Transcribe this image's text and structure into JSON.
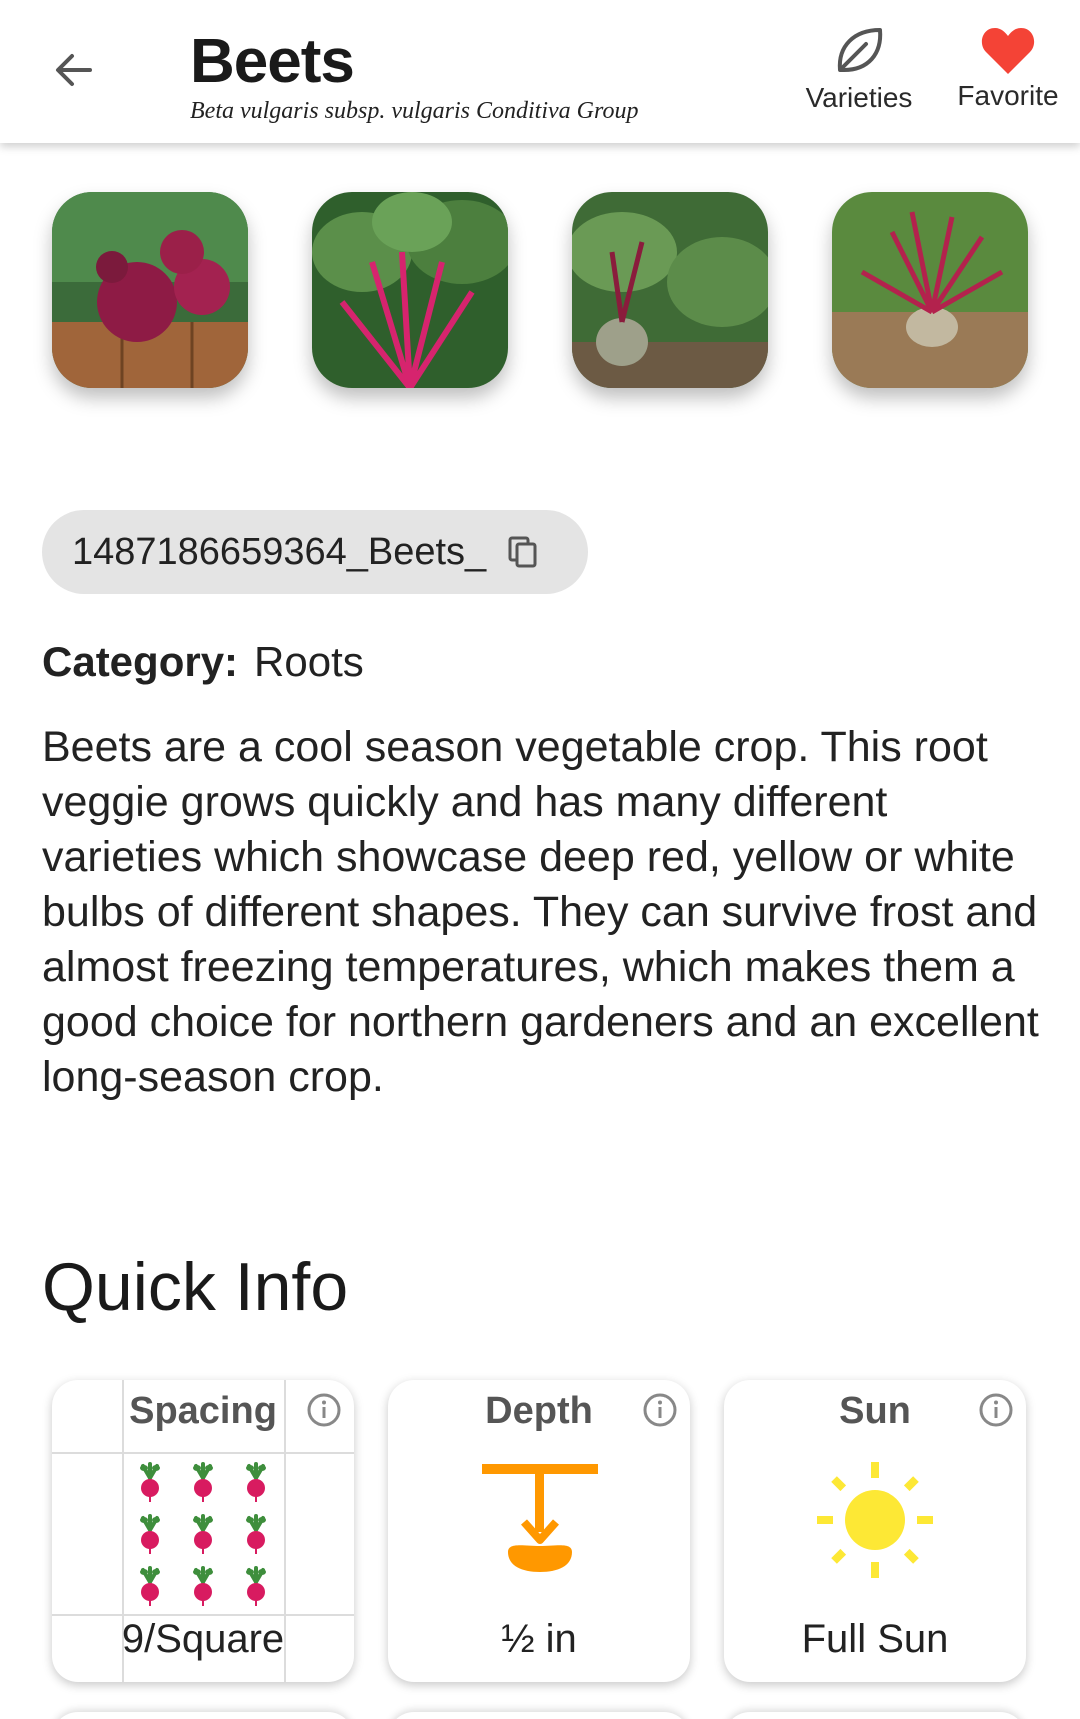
{
  "header": {
    "title": "Beets",
    "subtitle": "Beta vulgaris subsp. vulgaris Conditiva Group",
    "varieties_label": "Varieties",
    "favorite_label": "Favorite",
    "favorite_color": "#f44336"
  },
  "gallery": {
    "images": [
      "beets-on-wooden-table",
      "beet-leaves-pink-stems",
      "beets-growing-in-garden",
      "beet-root-in-soil"
    ]
  },
  "plant_id": "1487186659364_Beets_",
  "category": {
    "label": "Category:",
    "value": "Roots"
  },
  "description": "Beets are a cool season vegetable crop. This root veggie grows quickly and has many different varieties which showcase deep red, yellow or white bulbs of different shapes. They can survive frost and almost freezing temperatures, which makes them a good choice for northern gardeners and an excellent long-season crop.",
  "quick_info": {
    "title": "Quick Info",
    "cards": [
      {
        "title": "Spacing",
        "value": "9/Square",
        "icon": "beet-grid-icon"
      },
      {
        "title": "Depth",
        "value": "½ in",
        "icon": "seed-depth-icon",
        "color": "#ff9800"
      },
      {
        "title": "Sun",
        "value": "Full Sun",
        "icon": "sun-icon",
        "color": "#fde835"
      }
    ]
  }
}
